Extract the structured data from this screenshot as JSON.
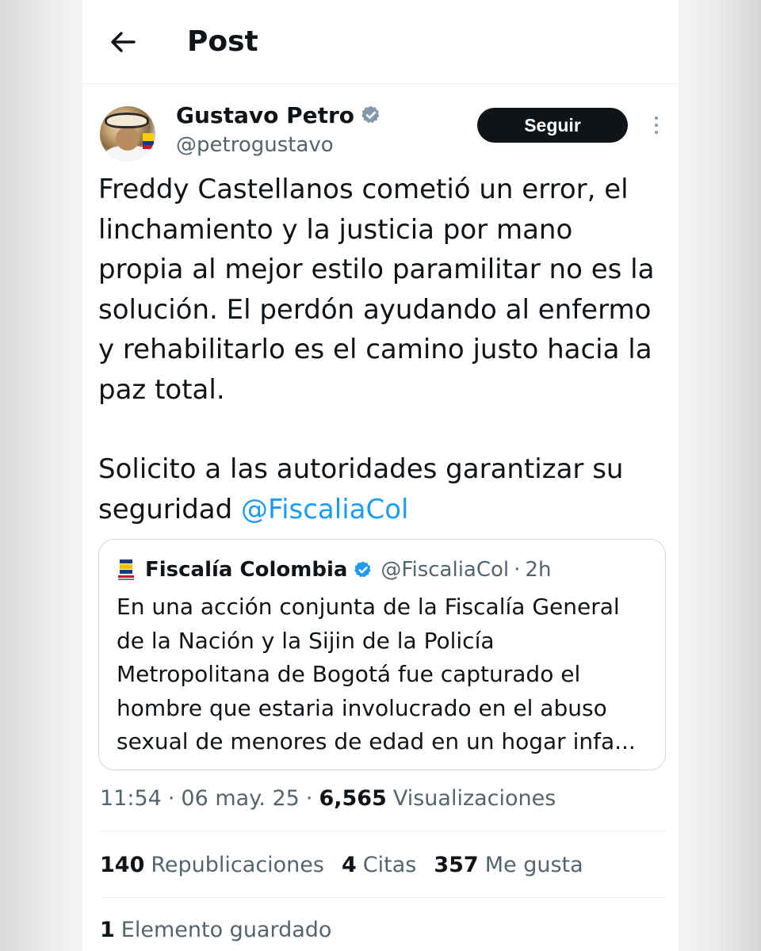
{
  "header": {
    "title": "Post",
    "back_icon": "arrow-left-icon"
  },
  "author": {
    "name": "Gustavo Petro",
    "handle": "@petrogustavo",
    "verified": true,
    "follow_label": "Seguir",
    "more_icon": "more-vertical-icon"
  },
  "post": {
    "paragraph_1": "Freddy Castellanos cometió un error, el linchamiento y la justicia por mano propia al mejor estilo paramilitar no es la solución. El perdón ayudando al enfermo y rehabilitarlo es el camino justo hacia la paz total.",
    "paragraph_2_text": "Solicito a las autoridades garantizar su seguridad ",
    "paragraph_2_mention": "@FiscaliaCol"
  },
  "quote": {
    "name": "Fiscalía Colombia",
    "handle": "@FiscaliaCol",
    "separator": "·",
    "time": "2h",
    "body": "En una acción conjunta de la Fiscalía General de la Nación y la Sijin de la Policía Metropolitana de Bogotá fue capturado el hombre que estaria involucrado en el abuso sexual de menores de edad en un hogar infa...",
    "logo_icon": "fiscalia-logo-icon"
  },
  "meta": {
    "time": "11:54",
    "date": "06 may. 25",
    "separator": "·",
    "views_count": "6,565",
    "views_label": "Visualizaciones"
  },
  "stats": {
    "reposts_count": "140",
    "reposts_label": "Republicaciones",
    "quotes_count": "4",
    "quotes_label": "Citas",
    "likes_count": "357",
    "likes_label": "Me gusta"
  },
  "saved": {
    "count": "1",
    "label": "Elemento guardado"
  },
  "colors": {
    "link": "#1d9bf0",
    "text": "#0f1419",
    "secondary": "#536471",
    "follow_bg": "#0f1419"
  }
}
